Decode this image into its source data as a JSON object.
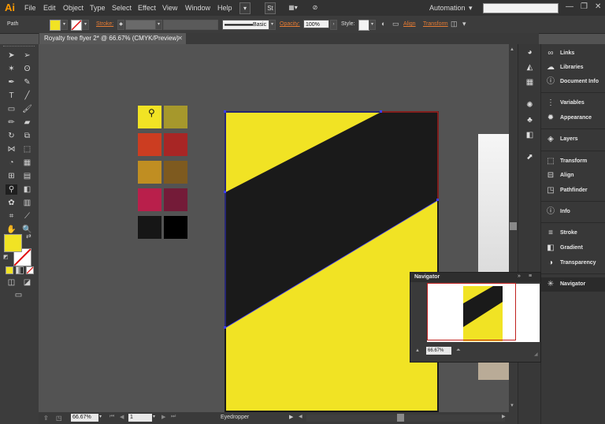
{
  "app": {
    "logo": "Ai"
  },
  "menu": [
    "File",
    "Edit",
    "Object",
    "Type",
    "Select",
    "Effect",
    "View",
    "Window",
    "Help"
  ],
  "menubar": {
    "badge": "St",
    "workspace": "Automation"
  },
  "control": {
    "selection": "Path",
    "stroke_label": "Stroke:",
    "brush_value": "Basic",
    "opacity_label": "Opacity:",
    "opacity_value": "100%",
    "style_label": "Style:",
    "align_label": "Align",
    "transform_label": "Transform"
  },
  "document": {
    "tab_title": "Royalty free flyer 2* @ 66.67% (CMYK/Preview)"
  },
  "status": {
    "zoom": "66.67%",
    "artboard": "1",
    "tool": "Eyedropper"
  },
  "colors": {
    "fill": "#f1e324",
    "yellow": "#f1e324",
    "black": "#1a1a1a",
    "accent": "#e87c32",
    "selection": "#3d3dff",
    "artboard_edge": "#c0201e"
  },
  "swatches": [
    [
      "#f1e324",
      "#a6982c"
    ],
    [
      "#cc3d21",
      "#a82625"
    ],
    [
      "#c08e22",
      "#7e5a1f"
    ],
    [
      "#b91f4b",
      "#741b38"
    ],
    [
      "#161616",
      "#000000"
    ]
  ],
  "panels": [
    {
      "label": "Links",
      "icon": "links-icon"
    },
    {
      "label": "Libraries",
      "icon": "libraries-icon"
    },
    {
      "label": "Document Info",
      "icon": "document-info-icon"
    },
    {
      "label": "Variables",
      "icon": "variables-icon"
    },
    {
      "label": "Appearance",
      "icon": "appearance-icon"
    },
    {
      "label": "Layers",
      "icon": "layers-icon"
    },
    {
      "label": "Transform",
      "icon": "transform-icon"
    },
    {
      "label": "Align",
      "icon": "align-icon"
    },
    {
      "label": "Pathfinder",
      "icon": "pathfinder-icon"
    },
    {
      "label": "Info",
      "icon": "info-icon"
    },
    {
      "label": "Stroke",
      "icon": "stroke-icon"
    },
    {
      "label": "Gradient",
      "icon": "gradient-icon"
    },
    {
      "label": "Transparency",
      "icon": "transparency-icon"
    },
    {
      "label": "Navigator",
      "icon": "navigator-icon"
    }
  ],
  "navigator": {
    "title": "Navigator",
    "zoom": "66.67%"
  }
}
